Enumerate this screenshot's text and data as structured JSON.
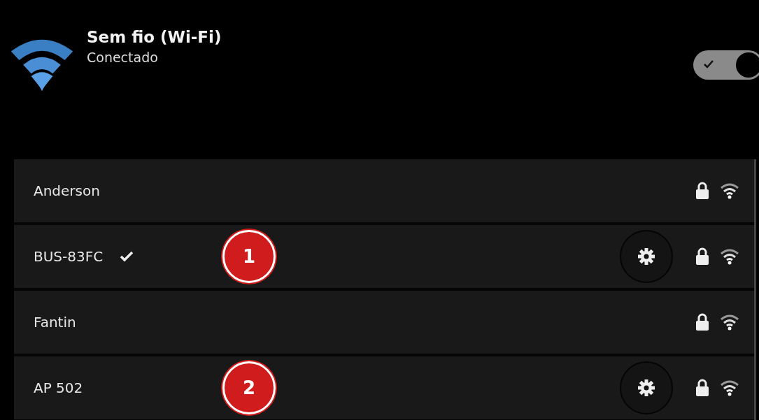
{
  "header": {
    "title": "Sem fio (Wi-Fi)",
    "status": "Conectado",
    "toggle": {
      "on": true
    }
  },
  "networks": [
    {
      "name": "Anderson",
      "connected": false,
      "settings": false,
      "secured": true
    },
    {
      "name": "BUS-83FC",
      "connected": true,
      "callout": "1",
      "settings": true,
      "secured": true
    },
    {
      "name": "Fantin",
      "connected": false,
      "settings": false,
      "secured": true
    },
    {
      "name": "AP 502",
      "connected": false,
      "callout": "2",
      "settings": true,
      "secured": true
    }
  ]
}
